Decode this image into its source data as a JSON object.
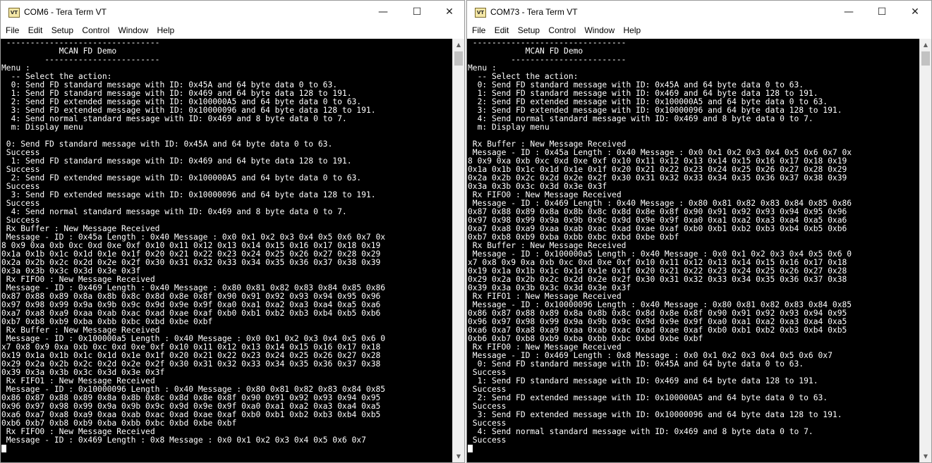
{
  "windows": [
    {
      "id": "left",
      "title": "COM6 - Tera Term VT",
      "menu": [
        "File",
        "Edit",
        "Setup",
        "Control",
        "Window",
        "Help"
      ],
      "terminal_lines": [
        " --------------------------------",
        "            MCAN FD Demo",
        "         ------------------------",
        "Menu :",
        "  -- Select the action:",
        "  0: Send FD standard message with ID: 0x45A and 64 byte data 0 to 63.",
        "  1: Send FD standard message with ID: 0x469 and 64 byte data 128 to 191.",
        "  2: Send FD extended message with ID: 0x100000A5 and 64 byte data 0 to 63.",
        "  3: Send FD extended message with ID: 0x10000096 and 64 byte data 128 to 191.",
        "  4: Send normal standard message with ID: 0x469 and 8 byte data 0 to 7.",
        "  m: Display menu",
        "",
        " 0: Send FD standard message with ID: 0x45A and 64 byte data 0 to 63.",
        " Success",
        "  1: Send FD standard message with ID: 0x469 and 64 byte data 128 to 191.",
        " Success",
        "  2: Send FD extended message with ID: 0x100000A5 and 64 byte data 0 to 63.",
        " Success",
        "  3: Send FD extended message with ID: 0x10000096 and 64 byte data 128 to 191.",
        " Success",
        "  4: Send normal standard message with ID: 0x469 and 8 byte data 0 to 7.",
        " Success",
        " Rx Buffer : New Message Received",
        " Message - ID : 0x45a Length : 0x40 Message : 0x0 0x1 0x2 0x3 0x4 0x5 0x6 0x7 0x",
        "8 0x9 0xa 0xb 0xc 0xd 0xe 0xf 0x10 0x11 0x12 0x13 0x14 0x15 0x16 0x17 0x18 0x19",
        "0x1a 0x1b 0x1c 0x1d 0x1e 0x1f 0x20 0x21 0x22 0x23 0x24 0x25 0x26 0x27 0x28 0x29",
        "0x2a 0x2b 0x2c 0x2d 0x2e 0x2f 0x30 0x31 0x32 0x33 0x34 0x35 0x36 0x37 0x38 0x39",
        "0x3a 0x3b 0x3c 0x3d 0x3e 0x3f",
        " Rx FIFO0 : New Message Received",
        " Message - ID : 0x469 Length : 0x40 Message : 0x80 0x81 0x82 0x83 0x84 0x85 0x86",
        "0x87 0x88 0x89 0x8a 0x8b 0x8c 0x8d 0x8e 0x8f 0x90 0x91 0x92 0x93 0x94 0x95 0x96",
        "0x97 0x98 0x99 0x9a 0x9b 0x9c 0x9d 0x9e 0x9f 0xa0 0xa1 0xa2 0xa3 0xa4 0xa5 0xa6",
        "0xa7 0xa8 0xa9 0xaa 0xab 0xac 0xad 0xae 0xaf 0xb0 0xb1 0xb2 0xb3 0xb4 0xb5 0xb6",
        "0xb7 0xb8 0xb9 0xba 0xbb 0xbc 0xbd 0xbe 0xbf",
        " Rx Buffer : New Message Received",
        " Message - ID : 0x100000a5 Length : 0x40 Message : 0x0 0x1 0x2 0x3 0x4 0x5 0x6 0",
        "x7 0x8 0x9 0xa 0xb 0xc 0xd 0xe 0xf 0x10 0x11 0x12 0x13 0x14 0x15 0x16 0x17 0x18",
        "0x19 0x1a 0x1b 0x1c 0x1d 0x1e 0x1f 0x20 0x21 0x22 0x23 0x24 0x25 0x26 0x27 0x28",
        "0x29 0x2a 0x2b 0x2c 0x2d 0x2e 0x2f 0x30 0x31 0x32 0x33 0x34 0x35 0x36 0x37 0x38",
        "0x39 0x3a 0x3b 0x3c 0x3d 0x3e 0x3f",
        " Rx FIFO1 : New Message Received",
        " Message - ID : 0x10000096 Length : 0x40 Message : 0x80 0x81 0x82 0x83 0x84 0x85",
        "0x86 0x87 0x88 0x89 0x8a 0x8b 0x8c 0x8d 0x8e 0x8f 0x90 0x91 0x92 0x93 0x94 0x95",
        "0x96 0x97 0x98 0x99 0x9a 0x9b 0x9c 0x9d 0x9e 0x9f 0xa0 0xa1 0xa2 0xa3 0xa4 0xa5",
        "0xa6 0xa7 0xa8 0xa9 0xaa 0xab 0xac 0xad 0xae 0xaf 0xb0 0xb1 0xb2 0xb3 0xb4 0xb5",
        "0xb6 0xb7 0xb8 0xb9 0xba 0xbb 0xbc 0xbd 0xbe 0xbf",
        " Rx FIFO0 : New Message Received",
        " Message - ID : 0x469 Length : 0x8 Message : 0x0 0x1 0x2 0x3 0x4 0x5 0x6 0x7",
        ""
      ]
    },
    {
      "id": "right",
      "title": "COM73 - Tera Term VT",
      "menu": [
        "File",
        "Edit",
        "Setup",
        "Control",
        "Window",
        "Help"
      ],
      "terminal_lines": [
        " --------------------------------",
        "            MCAN FD Demo",
        "         ------------------------",
        "Menu :",
        "  -- Select the action:",
        "  0: Send FD standard message with ID: 0x45A and 64 byte data 0 to 63.",
        "  1: Send FD standard message with ID: 0x469 and 64 byte data 128 to 191.",
        "  2: Send FD extended message with ID: 0x100000A5 and 64 byte data 0 to 63.",
        "  3: Send FD extended message with ID: 0x10000096 and 64 byte data 128 to 191.",
        "  4: Send normal standard message with ID: 0x469 and 8 byte data 0 to 7.",
        "  m: Display menu",
        "",
        " Rx Buffer : New Message Received",
        " Message - ID : 0x45a Length : 0x40 Message : 0x0 0x1 0x2 0x3 0x4 0x5 0x6 0x7 0x",
        "8 0x9 0xa 0xb 0xc 0xd 0xe 0xf 0x10 0x11 0x12 0x13 0x14 0x15 0x16 0x17 0x18 0x19",
        "0x1a 0x1b 0x1c 0x1d 0x1e 0x1f 0x20 0x21 0x22 0x23 0x24 0x25 0x26 0x27 0x28 0x29",
        "0x2a 0x2b 0x2c 0x2d 0x2e 0x2f 0x30 0x31 0x32 0x33 0x34 0x35 0x36 0x37 0x38 0x39",
        "0x3a 0x3b 0x3c 0x3d 0x3e 0x3f",
        " Rx FIFO0 : New Message Received",
        " Message - ID : 0x469 Length : 0x40 Message : 0x80 0x81 0x82 0x83 0x84 0x85 0x86",
        "0x87 0x88 0x89 0x8a 0x8b 0x8c 0x8d 0x8e 0x8f 0x90 0x91 0x92 0x93 0x94 0x95 0x96",
        "0x97 0x98 0x99 0x9a 0x9b 0x9c 0x9d 0x9e 0x9f 0xa0 0xa1 0xa2 0xa3 0xa4 0xa5 0xa6",
        "0xa7 0xa8 0xa9 0xaa 0xab 0xac 0xad 0xae 0xaf 0xb0 0xb1 0xb2 0xb3 0xb4 0xb5 0xb6",
        "0xb7 0xb8 0xb9 0xba 0xbb 0xbc 0xbd 0xbe 0xbf",
        " Rx Buffer : New Message Received",
        " Message - ID : 0x100000a5 Length : 0x40 Message : 0x0 0x1 0x2 0x3 0x4 0x5 0x6 0",
        "x7 0x8 0x9 0xa 0xb 0xc 0xd 0xe 0xf 0x10 0x11 0x12 0x13 0x14 0x15 0x16 0x17 0x18",
        "0x19 0x1a 0x1b 0x1c 0x1d 0x1e 0x1f 0x20 0x21 0x22 0x23 0x24 0x25 0x26 0x27 0x28",
        "0x29 0x2a 0x2b 0x2c 0x2d 0x2e 0x2f 0x30 0x31 0x32 0x33 0x34 0x35 0x36 0x37 0x38",
        "0x39 0x3a 0x3b 0x3c 0x3d 0x3e 0x3f",
        " Rx FIFO1 : New Message Received",
        " Message - ID : 0x10000096 Length : 0x40 Message : 0x80 0x81 0x82 0x83 0x84 0x85",
        "0x86 0x87 0x88 0x89 0x8a 0x8b 0x8c 0x8d 0x8e 0x8f 0x90 0x91 0x92 0x93 0x94 0x95",
        "0x96 0x97 0x98 0x99 0x9a 0x9b 0x9c 0x9d 0x9e 0x9f 0xa0 0xa1 0xa2 0xa3 0xa4 0xa5",
        "0xa6 0xa7 0xa8 0xa9 0xaa 0xab 0xac 0xad 0xae 0xaf 0xb0 0xb1 0xb2 0xb3 0xb4 0xb5",
        "0xb6 0xb7 0xb8 0xb9 0xba 0xbb 0xbc 0xbd 0xbe 0xbf",
        " Rx FIFO0 : New Message Received",
        " Message - ID : 0x469 Length : 0x8 Message : 0x0 0x1 0x2 0x3 0x4 0x5 0x6 0x7",
        "  0: Send FD standard message with ID: 0x45A and 64 byte data 0 to 63.",
        " Success",
        "  1: Send FD standard message with ID: 0x469 and 64 byte data 128 to 191.",
        " Success",
        "  2: Send FD extended message with ID: 0x100000A5 and 64 byte data 0 to 63.",
        " Success",
        "  3: Send FD extended message with ID: 0x10000096 and 64 byte data 128 to 191.",
        " Success",
        "  4: Send normal standard message with ID: 0x469 and 8 byte data 0 to 7.",
        " Success",
        ""
      ]
    }
  ],
  "icons": {
    "app": "teraterm-icon",
    "minimize": "minimize-icon",
    "maximize": "maximize-icon",
    "close": "close-icon"
  },
  "colors": {
    "terminal_bg": "#000000",
    "terminal_fg": "#ffffff"
  }
}
